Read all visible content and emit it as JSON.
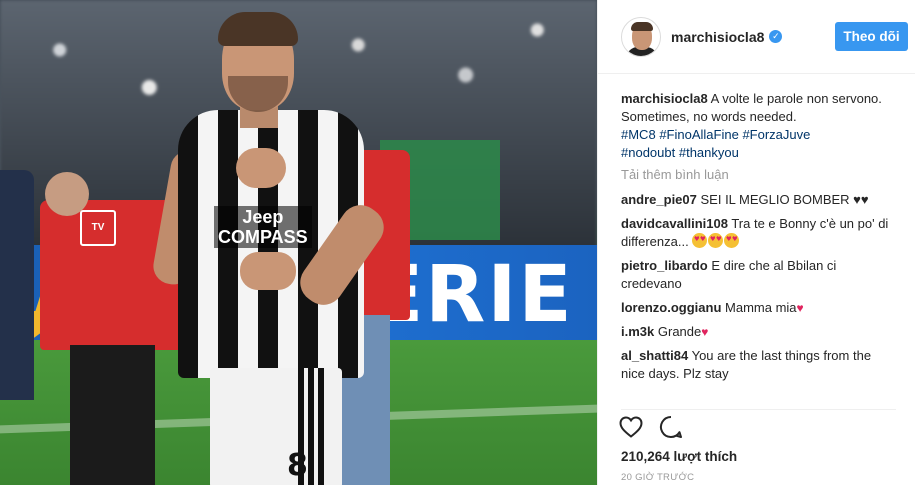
{
  "post": {
    "photo": {
      "banner_text": "ERIE",
      "jersey_sponsor_line1": "Jeep",
      "jersey_sponsor_line2": "COMPASS",
      "shorts_number": "8",
      "staff_logo": "TV"
    },
    "header": {
      "username": "marchisiocla8",
      "verified_badge": "✓",
      "follow_label": "Theo dõi"
    },
    "caption": {
      "username": "marchisiocla8",
      "text_line1": "A volte le parole non servono.",
      "text_line2": "Sometimes, no words needed.",
      "hashtags": [
        "#MC8",
        "#FinoAllaFine",
        "#ForzaJuve",
        "#nodoubt",
        "#thankyou"
      ]
    },
    "load_more_label": "Tải thêm bình luận",
    "comments": [
      {
        "user": "andre_pie07",
        "text": "SEI IL MEGLIO BOMBER ♥♥"
      },
      {
        "user": "davidcavallini108",
        "text": "Tra te e Bonny c'è un po' di differenza..."
      },
      {
        "user": "pietro_libardo",
        "text": "E dire che al Bbilan ci credevano"
      },
      {
        "user": "lorenzo.oggianu",
        "text": "Mamma mia"
      },
      {
        "user": "i.m3k",
        "text": "Grande"
      },
      {
        "user": "al_shatti84",
        "text": "You are the last things from the nice days. Plz stay"
      }
    ],
    "comment_suffix_heart": "♥",
    "actions": {
      "like_icon": "heart-outline-icon",
      "comment_icon": "speech-bubble-icon"
    },
    "likes_text": "210,264 lượt thích",
    "timestamp": "20 GIỜ TRƯỚC",
    "colors": {
      "accent": "#3897f0",
      "hashtag": "#003569",
      "muted": "#999999"
    }
  }
}
